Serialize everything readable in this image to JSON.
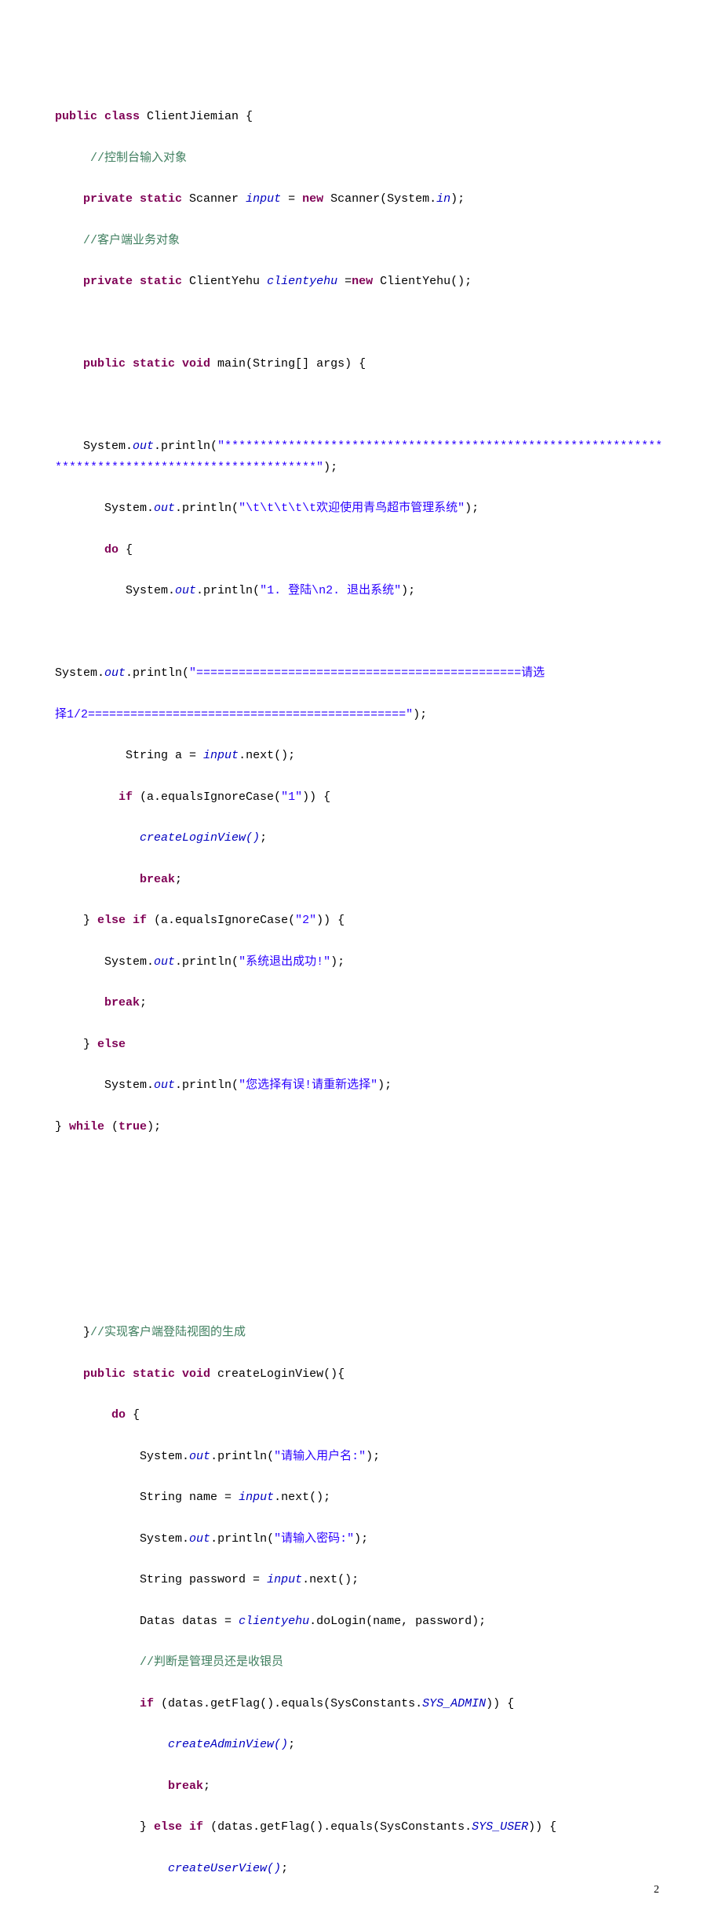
{
  "page_number": "2",
  "code": {
    "line1": {
      "kw1": "public class",
      "cls": " ClientJiemian {"
    },
    "line2": {
      "com": " //控制台输入对象"
    },
    "line3": {
      "kw1": "private static",
      "t1": " Scanner ",
      "fld": "input",
      "t2": " = ",
      "kw2": "new",
      "t3": " Scanner(System.",
      "fld2": "in",
      "t4": ");"
    },
    "line4": {
      "com": "//客户端业务对象"
    },
    "line5": {
      "kw1": "private static",
      "t1": " ClientYehu ",
      "fld": "clientyehu",
      "t2": " =",
      "kw2": "new",
      "t3": " ClientYehu();"
    },
    "line6": {
      "kw1": "public static void",
      "t1": " main(String[] args) {"
    },
    "line7": {
      "t1": "System.",
      "fld": "out",
      "t2": ".println(",
      "str": "\"***************************************************************************************************\"",
      "t3": ");"
    },
    "line8": {
      "t1": "System.",
      "fld": "out",
      "t2": ".println(",
      "str": "\"\\t\\t\\t\\t\\t欢迎使用青鸟超市管理系统\"",
      "t3": ");"
    },
    "line9": {
      "kw": "do",
      "t1": " {"
    },
    "line10": {
      "t1": "System.",
      "fld": "out",
      "t2": ".println(",
      "str": "\"1. 登陆\\n2. 退出系统\"",
      "t3": ");"
    },
    "line11a": {
      "t1": "System.",
      "fld": "out",
      "t2": ".println(",
      "str": "\"==============================================请选"
    },
    "line11b": {
      "str": "择1/2=============================================\"",
      "t3": ");"
    },
    "line12": {
      "t1": " String a = ",
      "fld": "input",
      "t2": ".next();"
    },
    "line13": {
      "kw": "if",
      "t1": " (a.equalsIgnoreCase(",
      "str": "\"1\"",
      "t2": ")) {"
    },
    "line14": {
      "fld": "createLoginView()",
      "t1": ";"
    },
    "line15": {
      "kw": "break",
      "t1": ";"
    },
    "line16": {
      "t1": "} ",
      "kw1": "else if",
      "t2": " (a.equalsIgnoreCase(",
      "str": "\"2\"",
      "t3": ")) {"
    },
    "line17": {
      "t1": "System.",
      "fld": "out",
      "t2": ".println(",
      "str": "\"系统退出成功!\"",
      "t3": ");"
    },
    "line18": {
      "kw": "break",
      "t1": ";"
    },
    "line19": {
      "t1": "} ",
      "kw": "else"
    },
    "line20": {
      "t1": "System.",
      "fld": "out",
      "t2": ".println(",
      "str": "\"您选择有误!请重新选择\"",
      "t3": ");"
    },
    "line21": {
      "t1": "} ",
      "kw": "while",
      "t2": " (",
      "kw2": "true",
      "t3": ");"
    },
    "line22": {
      "t1": "}",
      "com": "//实现客户端登陆视图的生成"
    },
    "line23": {
      "kw1": "public static void",
      "t1": " createLoginView(){"
    },
    "line24": {
      "kw": "do",
      "t1": " {"
    },
    "line25": {
      "t1": "System.",
      "fld": "out",
      "t2": ".println(",
      "str": "\"请输入用户名:\"",
      "t3": ");"
    },
    "line26": {
      "t1": "String name = ",
      "fld": "input",
      "t2": ".next();"
    },
    "line27": {
      "t1": "System.",
      "fld": "out",
      "t2": ".println(",
      "str": "\"请输入密码:\"",
      "t3": ");"
    },
    "line28": {
      "t1": "String password = ",
      "fld": "input",
      "t2": ".next();"
    },
    "line29": {
      "t1": "Datas datas = ",
      "fld": "clientyehu",
      "t2": ".doLogin(name, password);"
    },
    "line30": {
      "com": "//判断是管理员还是收银员"
    },
    "line31": {
      "kw": "if",
      "t1": " (datas.getFlag().equals(SysConstants.",
      "fld": "SYS_ADMIN",
      "t2": ")) {"
    },
    "line32": {
      "fld": "createAdminView()",
      "t1": ";"
    },
    "line33": {
      "kw": "break",
      "t1": ";"
    },
    "line34": {
      "t1": "} ",
      "kw1": "else if",
      "t2": " (datas.getFlag().equals(SysConstants.",
      "fld": "SYS_USER",
      "t3": ")) {"
    },
    "line35": {
      "fld": "createUserView()",
      "t1": ";"
    }
  }
}
